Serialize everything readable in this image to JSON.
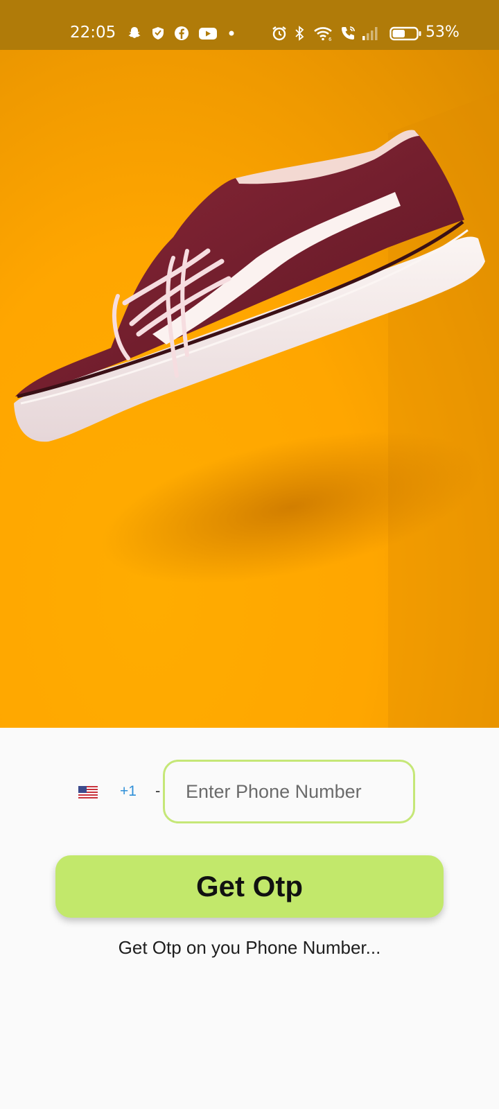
{
  "status_bar": {
    "time": "22:05",
    "battery_percent": "53%",
    "icons": [
      "snapchat-icon",
      "shield-icon",
      "facebook-icon",
      "youtube-icon",
      "dot-icon",
      "alarm-icon",
      "bluetooth-icon",
      "wifi-icon",
      "wifi-call-icon",
      "signal-icon",
      "battery-icon"
    ],
    "battery_level": 0.53
  },
  "hero": {
    "image": "burgundy-sneaker-on-orange-background"
  },
  "form": {
    "country_flag": "us-flag-icon",
    "dial_code": "+1",
    "separator": "-",
    "phone_placeholder": "Enter Phone Number",
    "phone_value": "",
    "submit_label": "Get Otp",
    "hint": "Get Otp on you Phone Number..."
  },
  "colors": {
    "accent": "#c2e86b",
    "input_border": "#c5e777",
    "hero_background": "#ffa600",
    "status_bar": "#b07b09",
    "dial_code": "#2f8fd8"
  }
}
